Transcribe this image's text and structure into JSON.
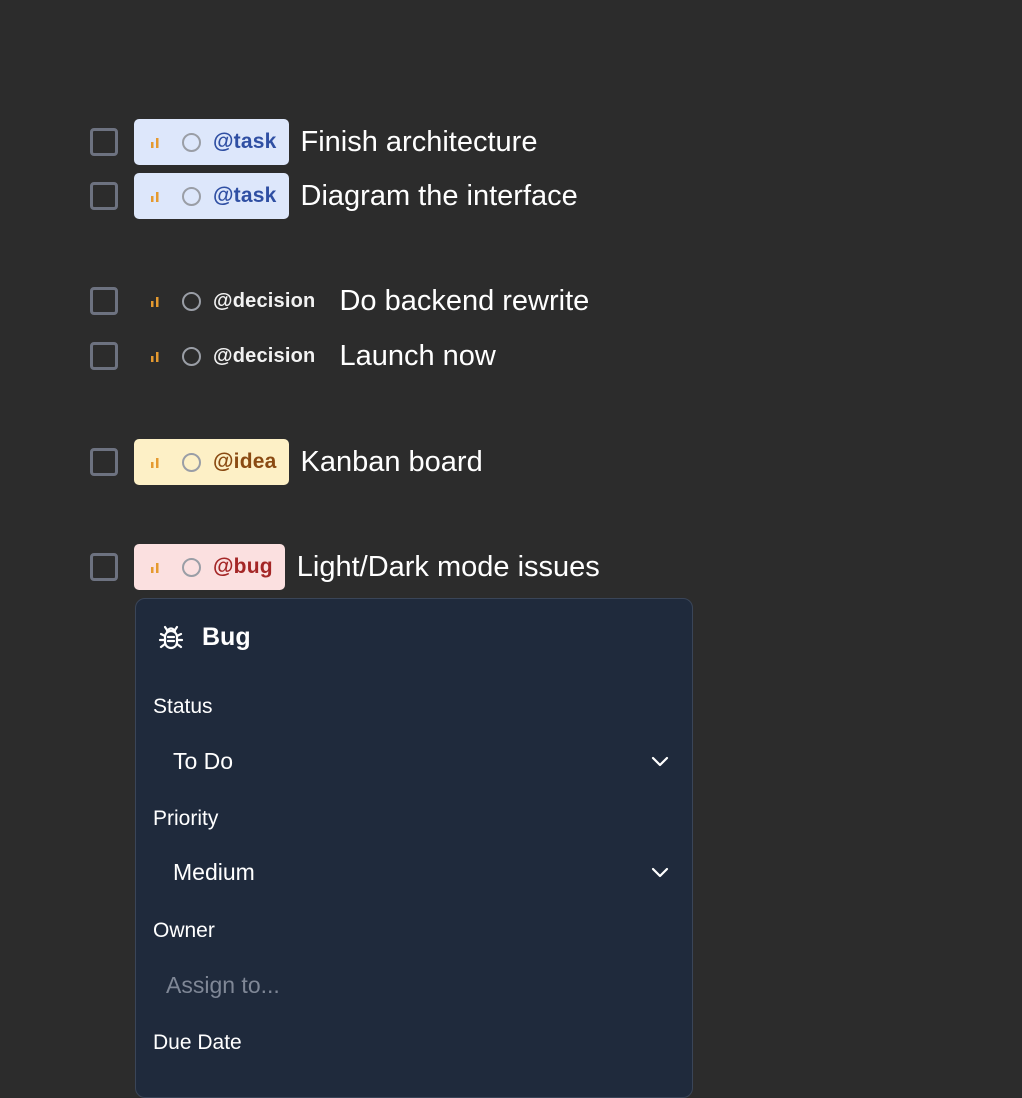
{
  "items": [
    {
      "tag": "@task",
      "text": "Finish architecture"
    },
    {
      "tag": "@task",
      "text": "Diagram the interface"
    },
    {
      "tag": "@decision",
      "text": "Do backend rewrite"
    },
    {
      "tag": "@decision",
      "text": "Launch now"
    },
    {
      "tag": "@idea",
      "text": "Kanban board"
    },
    {
      "tag": "@bug",
      "text": "Light/Dark mode issues"
    }
  ],
  "popup": {
    "title": "Bug",
    "status_label": "Status",
    "status_value": "To Do",
    "priority_label": "Priority",
    "priority_value": "Medium",
    "owner_label": "Owner",
    "owner_placeholder": "Assign to...",
    "due_date_label": "Due Date"
  },
  "icons": {
    "priority": "priority-bars-icon",
    "status": "status-circle-icon",
    "popup": "bug-icon",
    "dropdown": "chevron-down-icon"
  },
  "colors": {
    "background": "#2c2c2c",
    "task_chip": "#dde7fb",
    "task_text": "#2f4fa3",
    "idea_chip": "#fdf0c6",
    "idea_text": "#8a4a12",
    "bug_chip": "#fbe0e0",
    "bug_text": "#a42626",
    "priority_accent": "#e59a2f",
    "popup_background": "#1f2a3c"
  }
}
